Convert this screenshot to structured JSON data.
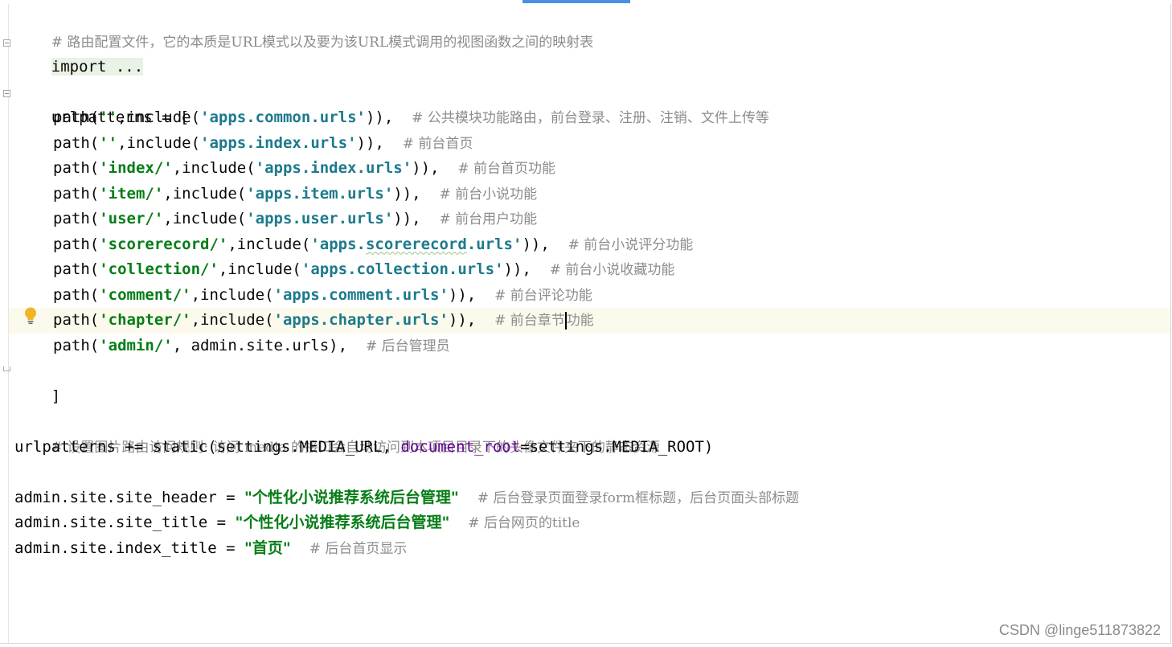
{
  "lines": {
    "l1_comment": "# 路由配置文件，它的本质是URL模式以及要为该URL模式调用的视图函数之间的映射表",
    "l2_import": "import ...",
    "l4_open": "urlpatterns = [",
    "p1": {
      "call": "path(",
      "route": "''",
      "mid": ",include(",
      "module": "'apps.common.urls'",
      "close": ")),",
      "comment": "# 公共模块功能路由，前台登录、注册、注销、文件上传等"
    },
    "p2": {
      "call": "path(",
      "route": "''",
      "mid": ",include(",
      "module": "'apps.index.urls'",
      "close": ")),",
      "comment": "# 前台首页"
    },
    "p3": {
      "call": "path(",
      "route": "'index/'",
      "mid": ",include(",
      "module": "'apps.index.urls'",
      "close": ")),",
      "comment": "# 前台首页功能"
    },
    "p4": {
      "call": "path(",
      "route": "'item/'",
      "mid": ",include(",
      "module": "'apps.item.urls'",
      "close": ")),",
      "comment": "# 前台小说功能"
    },
    "p5": {
      "call": "path(",
      "route": "'user/'",
      "mid": ",include(",
      "module": "'apps.user.urls'",
      "close": ")),",
      "comment": "# 前台用户功能"
    },
    "p6": {
      "call": "path(",
      "route": "'scorerecord/'",
      "mid": ",include(",
      "module_a": "'apps.",
      "module_b": "scorerecord",
      "module_c": ".urls'",
      "close": ")),",
      "comment": "# 前台小说评分功能"
    },
    "p7": {
      "call": "path(",
      "route": "'collection/'",
      "mid": ",include(",
      "module": "'apps.collection.urls'",
      "close": ")),",
      "comment": "# 前台小说收藏功能"
    },
    "p8": {
      "call": "path(",
      "route": "'comment/'",
      "mid": ",include(",
      "module": "'apps.comment.urls'",
      "close": ")),",
      "comment": "# 前台评论功能"
    },
    "p9": {
      "call": "path(",
      "route": "'chapter/'",
      "mid": ",include(",
      "module": "'apps.chapter.urls'",
      "close": ")),",
      "comment_a": "# 前台章节",
      "comment_b": "功能"
    },
    "p10": {
      "call": "path(",
      "route": "'admin/'",
      "rest": ", admin.site.urls),",
      "comment": "# 后台管理员"
    },
    "l15_close": "]",
    "l17_comment": "# 设置图片路由访问规则: 访问 media 的接口会自动访问到本项目目录下的头像文件夹下的静态资源",
    "l18": {
      "a": "urlpatterns += static(settings.MEDIA_URL, ",
      "named": "document_root",
      "b": "=settings.MEDIA_ROOT)"
    },
    "l20": {
      "a": "admin.site.site_header = ",
      "str": "\"个性化小说推荐系统后台管理\"",
      "comment": "# 后台登录页面登录form框标题，后台页面头部标题"
    },
    "l21": {
      "a": "admin.site.site_title = ",
      "str": "\"个性化小说推荐系统后台管理\"",
      "comment": "# 后台网页的title"
    },
    "l22": {
      "a": "admin.site.index_title = ",
      "str": "\"首页\"",
      "comment": "# 后台首页显示"
    }
  },
  "watermark": "CSDN @linge511873822",
  "colors": {
    "comment": "#8c8c8c",
    "string": "#067d17",
    "module_string": "#1d7a8c",
    "named_arg": "#660099",
    "current_line": "#fcfaed",
    "accent": "#4a8fe2"
  }
}
